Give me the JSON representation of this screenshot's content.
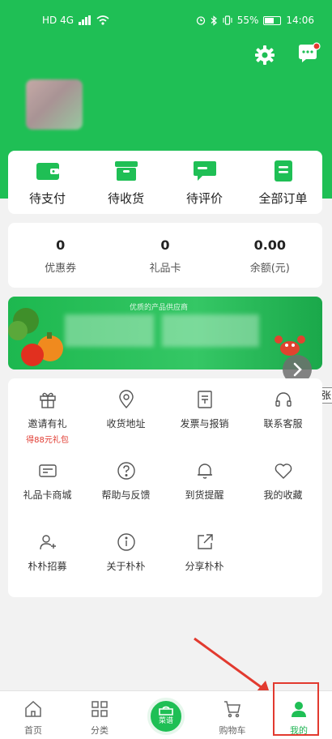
{
  "status_bar": {
    "network": "HD 4G",
    "battery_pct": "55%",
    "time": "14:06"
  },
  "header": {
    "settings_icon": "gear-icon",
    "message_icon": "chat-icon"
  },
  "orders": [
    {
      "label": "待支付",
      "icon": "wallet-icon"
    },
    {
      "label": "待收货",
      "icon": "box-icon"
    },
    {
      "label": "待评价",
      "icon": "comment-icon"
    },
    {
      "label": "全部订单",
      "icon": "list-icon"
    }
  ],
  "assets": [
    {
      "value": "0",
      "label": "优惠券"
    },
    {
      "value": "0",
      "label": "礼品卡"
    },
    {
      "value": "0.00",
      "label": "余额(元)"
    }
  ],
  "banner": {
    "top_text": "优质的产品供应商",
    "next_label": "下一张"
  },
  "services": [
    {
      "label": "邀请有礼",
      "sub": "得88元礼包",
      "icon": "gift-icon"
    },
    {
      "label": "收货地址",
      "icon": "location-icon"
    },
    {
      "label": "发票与报销",
      "icon": "invoice-icon"
    },
    {
      "label": "联系客服",
      "icon": "headset-icon"
    },
    {
      "label": "礼品卡商城",
      "icon": "card-icon"
    },
    {
      "label": "帮助与反馈",
      "icon": "help-icon"
    },
    {
      "label": "到货提醒",
      "icon": "bell-icon"
    },
    {
      "label": "我的收藏",
      "icon": "heart-icon"
    },
    {
      "label": "朴朴招募",
      "icon": "add-user-icon"
    },
    {
      "label": "关于朴朴",
      "icon": "info-icon"
    },
    {
      "label": "分享朴朴",
      "icon": "share-icon"
    }
  ],
  "tabbar": [
    {
      "label": "首页",
      "icon": "home-icon"
    },
    {
      "label": "分类",
      "icon": "grid-icon"
    },
    {
      "label": "菜谱",
      "icon": "cooking-pot-icon"
    },
    {
      "label": "购物车",
      "icon": "cart-icon"
    },
    {
      "label": "我的",
      "icon": "user-icon",
      "active": true
    }
  ],
  "colors": {
    "brand_green": "#1fbf55",
    "accent_red": "#e0382e",
    "annotation_red": "#e23a2f"
  }
}
